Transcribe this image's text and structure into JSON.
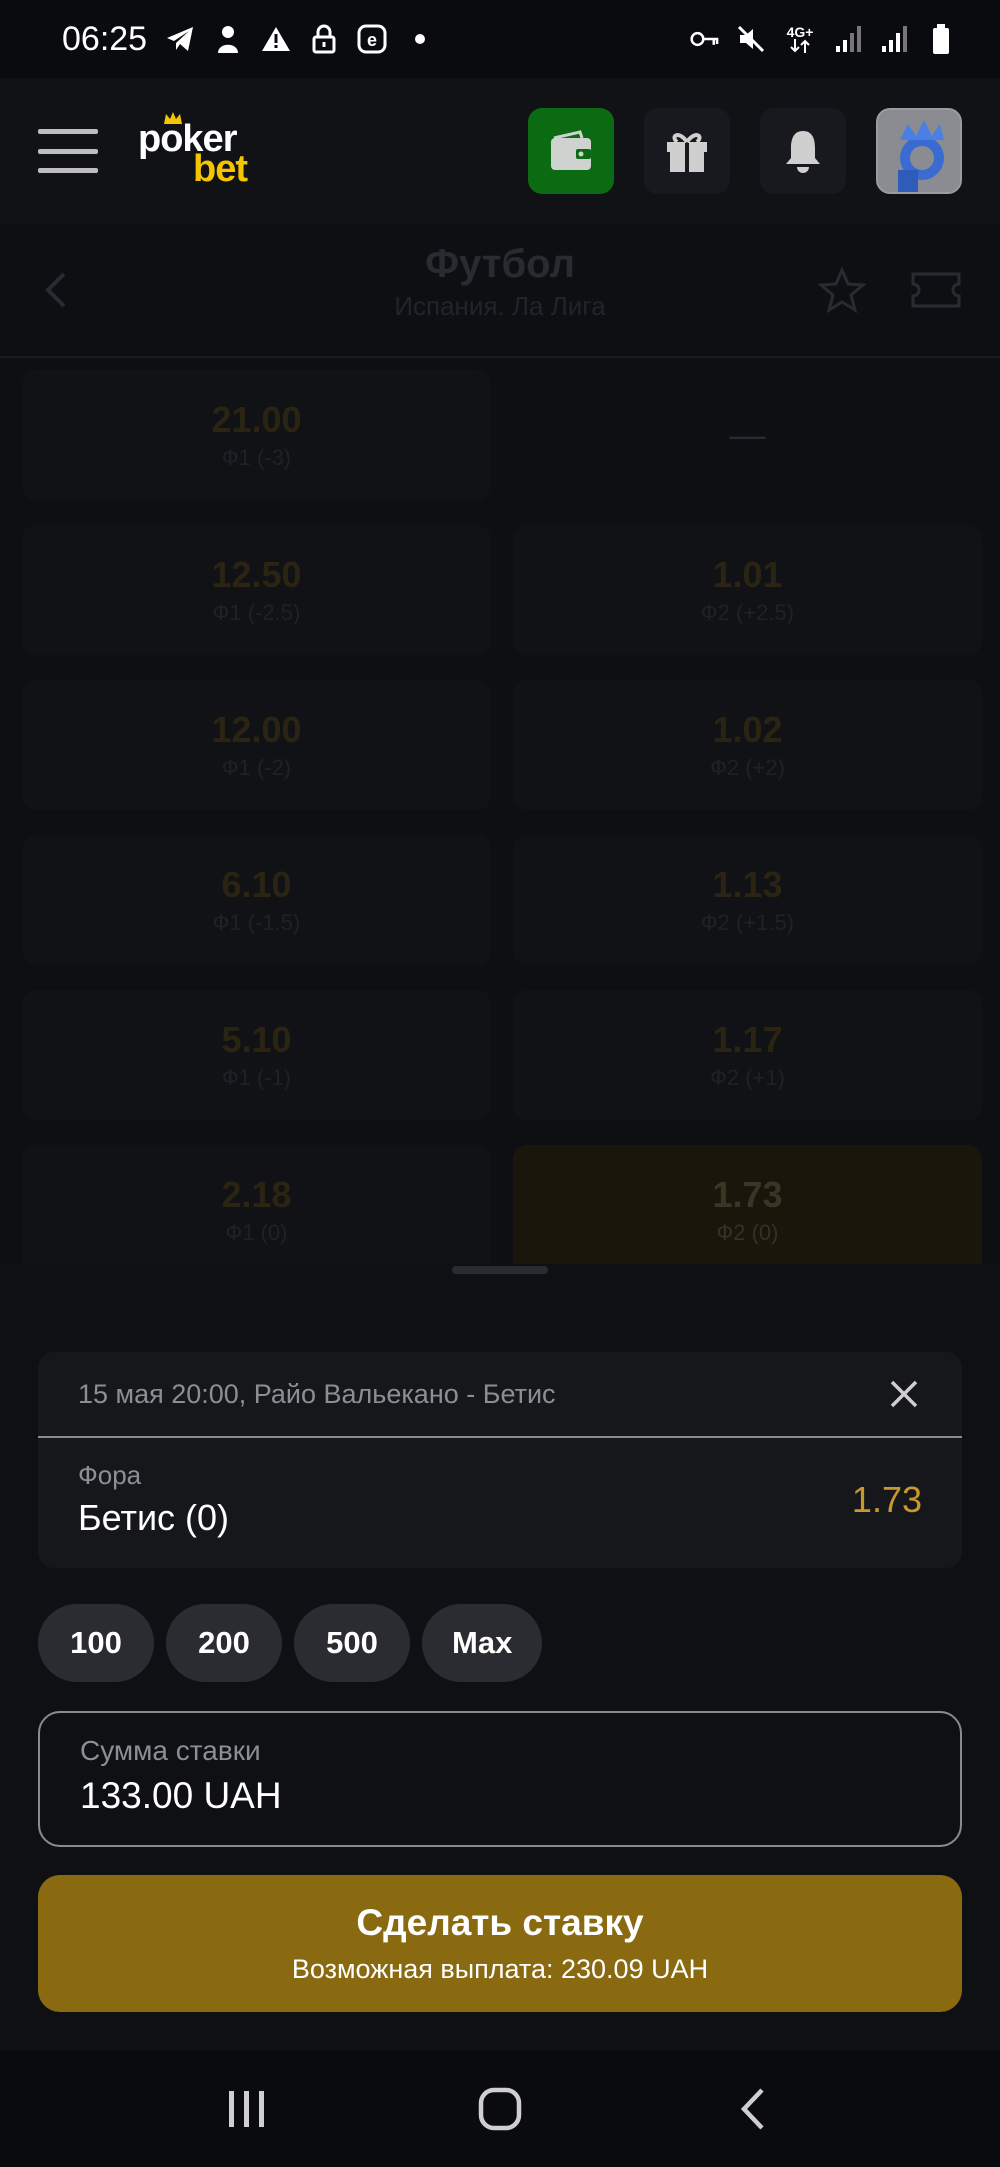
{
  "status_bar": {
    "time": "06:25",
    "network": "4G+"
  },
  "header": {
    "logo_top": "poker",
    "logo_bottom": "bet"
  },
  "sub_header": {
    "title": "Футбол",
    "subtitle": "Испания. Ла Лига"
  },
  "odds": {
    "rows": [
      {
        "left": {
          "value": "21.00",
          "label": "Ф1 (-3)"
        },
        "right": {
          "value": "—",
          "label": ""
        }
      },
      {
        "left": {
          "value": "12.50",
          "label": "Ф1 (-2.5)"
        },
        "right": {
          "value": "1.01",
          "label": "Ф2 (+2.5)"
        }
      },
      {
        "left": {
          "value": "12.00",
          "label": "Ф1 (-2)"
        },
        "right": {
          "value": "1.02",
          "label": "Ф2 (+2)"
        }
      },
      {
        "left": {
          "value": "6.10",
          "label": "Ф1 (-1.5)"
        },
        "right": {
          "value": "1.13",
          "label": "Ф2 (+1.5)"
        }
      },
      {
        "left": {
          "value": "5.10",
          "label": "Ф1 (-1)"
        },
        "right": {
          "value": "1.17",
          "label": "Ф2 (+1)"
        }
      },
      {
        "left": {
          "value": "2.18",
          "label": "Ф1 (0)"
        },
        "right": {
          "value": "1.73",
          "label": "Ф2 (0)"
        }
      }
    ]
  },
  "betslip": {
    "event": "15 мая 20:00, Райо Вальекано - Бетис",
    "market": "Фора",
    "selection": "Бетис (0)",
    "odd": "1.73",
    "quick_amounts": [
      "100",
      "200",
      "500",
      "Max"
    ],
    "stake_label": "Сумма ставки",
    "stake_value": "133.00 UAH",
    "place_bet_label": "Сделать ставку",
    "payout_text": "Возможная выплата: 230.09 UAH"
  },
  "colors": {
    "accent": "#8a6a10",
    "wallet": "#0b6b12",
    "odd_text": "#c9982a",
    "brand_yellow": "#f5c400"
  }
}
